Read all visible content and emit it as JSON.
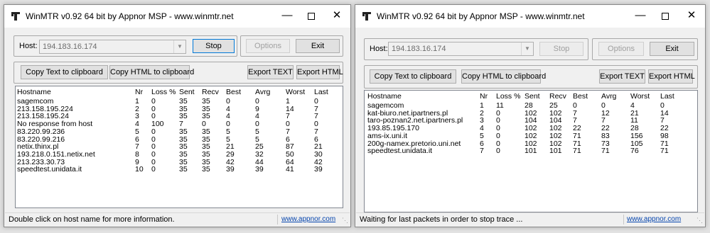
{
  "columns": [
    "Hostname",
    "Nr",
    "Loss %",
    "Sent",
    "Recv",
    "Best",
    "Avrg",
    "Worst",
    "Last"
  ],
  "window1": {
    "title": "WinMTR v0.92 64 bit by Appnor MSP - www.winmtr.net",
    "host_label": "Host:",
    "host_value": "194.183.16.174",
    "primary_button": "Stop",
    "options_label": "Options",
    "exit_label": "Exit",
    "copy_text_label": "Copy Text to clipboard",
    "copy_html_label": "Copy HTML to clipboard",
    "export_text_label": "Export TEXT",
    "export_html_label": "Export HTML",
    "rows": [
      [
        "sagemcom",
        "1",
        "0",
        "35",
        "35",
        "0",
        "0",
        "1",
        "0"
      ],
      [
        "213.158.195.224",
        "2",
        "0",
        "35",
        "35",
        "4",
        "9",
        "14",
        "7"
      ],
      [
        "213.158.195.24",
        "3",
        "0",
        "35",
        "35",
        "4",
        "4",
        "7",
        "7"
      ],
      [
        "No response from host",
        "4",
        "100",
        "7",
        "0",
        "0",
        "0",
        "0",
        "0"
      ],
      [
        "83.220.99.236",
        "5",
        "0",
        "35",
        "35",
        "5",
        "5",
        "7",
        "7"
      ],
      [
        "83.220.99.216",
        "6",
        "0",
        "35",
        "35",
        "5",
        "5",
        "6",
        "6"
      ],
      [
        "netix.thinx.pl",
        "7",
        "0",
        "35",
        "35",
        "21",
        "25",
        "87",
        "21"
      ],
      [
        "193.218.0.151.netix.net",
        "8",
        "0",
        "35",
        "35",
        "29",
        "32",
        "50",
        "30"
      ],
      [
        "213.233.30.73",
        "9",
        "0",
        "35",
        "35",
        "42",
        "44",
        "64",
        "42"
      ],
      [
        "speedtest.unidata.it",
        "10",
        "0",
        "35",
        "35",
        "39",
        "39",
        "41",
        "39"
      ]
    ],
    "status_text": "Double click on host name for more information.",
    "status_link": "www.appnor.com"
  },
  "window2": {
    "title": "WinMTR v0.92 64 bit by Appnor MSP - www.winmtr.net",
    "host_label": "Host:",
    "host_value": "194.183.16.174",
    "primary_button": "Stop",
    "options_label": "Options",
    "exit_label": "Exit",
    "copy_text_label": "Copy Text to clipboard",
    "copy_html_label": "Copy HTML to clipboard",
    "export_text_label": "Export TEXT",
    "export_html_label": "Export HTML",
    "rows": [
      [
        "sagemcom",
        "1",
        "11",
        "28",
        "25",
        "0",
        "0",
        "4",
        "0"
      ],
      [
        "kat-biuro.net.ipartners.pl",
        "2",
        "0",
        "102",
        "102",
        "7",
        "12",
        "21",
        "14"
      ],
      [
        "taro-poznan2.net.ipartners.pl",
        "3",
        "0",
        "104",
        "104",
        "7",
        "7",
        "11",
        "7"
      ],
      [
        "193.85.195.170",
        "4",
        "0",
        "102",
        "102",
        "22",
        "22",
        "28",
        "22"
      ],
      [
        "ams-ix.uni.it",
        "5",
        "0",
        "102",
        "102",
        "71",
        "83",
        "156",
        "98"
      ],
      [
        "200g-namex.pretorio.uni.net",
        "6",
        "0",
        "102",
        "102",
        "71",
        "73",
        "105",
        "71"
      ],
      [
        "speedtest.unidata.it",
        "7",
        "0",
        "101",
        "101",
        "71",
        "71",
        "76",
        "71"
      ]
    ],
    "status_text": "Waiting for last packets in order to stop trace ...",
    "status_link": "www.appnor.com"
  },
  "icons": {
    "app": "winmtr-app-icon",
    "minimize": "minimize-icon",
    "maximize": "maximize-icon",
    "close": "close-icon",
    "dropdown": "chevron-down-icon"
  }
}
